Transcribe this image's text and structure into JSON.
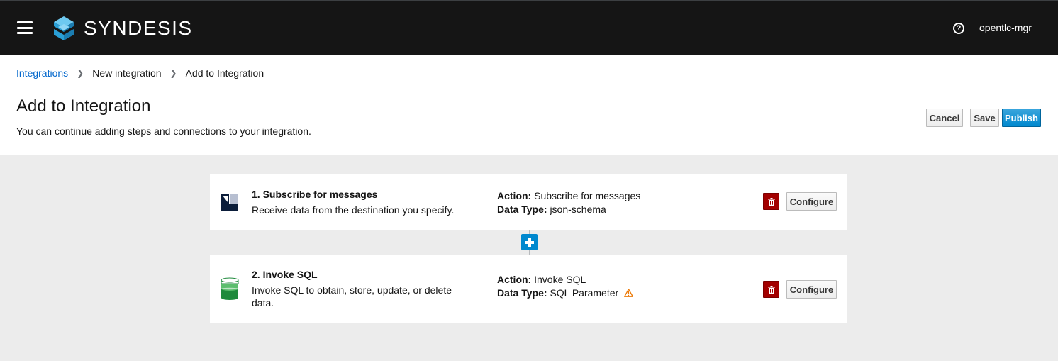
{
  "masthead": {
    "brand": "SYNDESIS",
    "user": "opentlc-mgr",
    "icons": {
      "menu": "hamburger-icon",
      "logo": "syndesis-logo",
      "help": "help-icon"
    }
  },
  "breadcrumb": {
    "items": [
      "Integrations",
      "New integration",
      "Add to Integration"
    ]
  },
  "header": {
    "title": "Add to Integration",
    "description": "You can continue adding steps and connections to your integration.",
    "cancel_label": "Cancel",
    "save_label": "Save",
    "publish_label": "Publish"
  },
  "steps": [
    {
      "title": "1. Subscribe for messages",
      "description": "Receive data from the destination you specify.",
      "action_label": "Action:",
      "action": "Subscribe for messages",
      "datatype_label": "Data Type:",
      "datatype": "json-schema",
      "icon": "amq-icon",
      "configure_label": "Configure"
    },
    {
      "title": "2. Invoke SQL",
      "description": "Invoke SQL to obtain, store, update, or delete data.",
      "action_label": "Action:",
      "action": "Invoke SQL",
      "datatype_label": "Data Type:",
      "datatype": "SQL Parameter",
      "icon": "database-icon",
      "warning_icon": "warning-icon",
      "configure_label": "Configure"
    }
  ],
  "colors": {
    "masthead": "#151515",
    "primary": "#0088ce",
    "link": "#0066cc",
    "danger": "#a30000",
    "warning": "#ec7a08",
    "canvas": "#ececec"
  }
}
